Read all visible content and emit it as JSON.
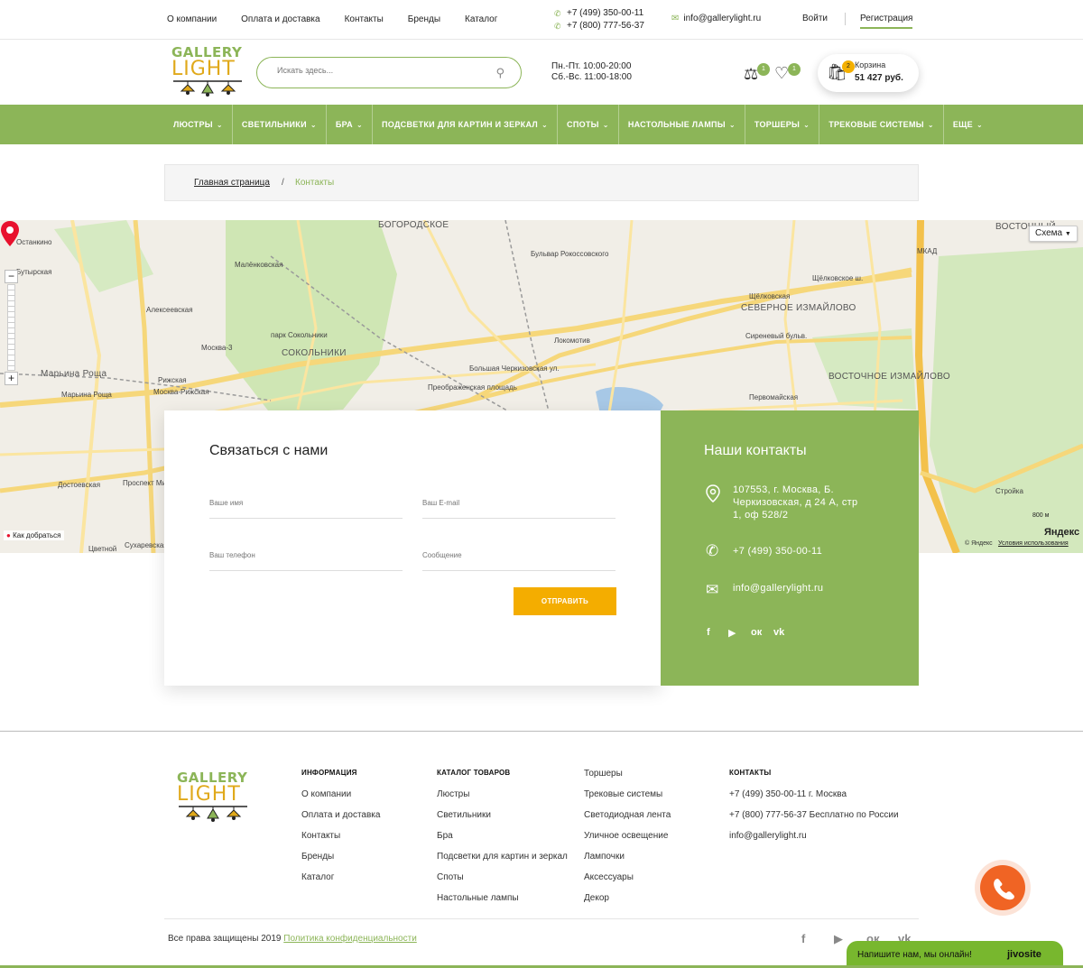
{
  "topbar": {
    "nav": [
      "О компании",
      "Оплата и доставка",
      "Контакты",
      "Бренды",
      "Каталог"
    ],
    "phone1": "+7 (499) 350-00-11",
    "phone2": "+7 (800) 777-56-37",
    "email": "info@gallerylight.ru",
    "login": "Войти",
    "register": "Регистрация"
  },
  "header": {
    "logo_line1": "GALLERY",
    "logo_line2": "LIGHT",
    "search_placeholder": "Искать здесь...",
    "hours_line1": "Пн.-Пт. 10:00-20:00",
    "hours_line2": "Сб.-Вс. 11:00-18:00",
    "compare_count": "1",
    "favorites_count": "1",
    "cart_count": "2",
    "cart_label": "Корзина",
    "cart_sum": "51 427 руб."
  },
  "menu": [
    "ЛЮСТРЫ",
    "СВЕТИЛЬНИКИ",
    "БРА",
    "ПОДСВЕТКИ ДЛЯ КАРТИН И ЗЕРКАЛ",
    "СПОТЫ",
    "НАСТОЛЬНЫЕ ЛАМПЫ",
    "ТОРШЕРЫ",
    "ТРЕКОВЫЕ СИСТЕМЫ",
    "ЕЩЕ"
  ],
  "breadcrumbs": {
    "home": "Главная страница",
    "separator": "/",
    "current": "Контакты"
  },
  "map": {
    "mode": "Схема",
    "route_link": "Как добраться",
    "copyright": "© Яндекс",
    "terms": "Условия использования",
    "brand": "Яндекс",
    "scale": "800 м",
    "labels": [
      "Останкино",
      "Бутырская",
      "Марьина Роща",
      "Алексеевская",
      "Рижская",
      "Москва-3",
      "Малёнковская",
      "СОКОЛЬНИКИ",
      "парк Сокольники",
      "БОГОРОДСКОЕ",
      "Бульвар Рокоссовского",
      "Локомотив",
      "Преображенская площадь",
      "Щёлковская",
      "СЕВЕРНОЕ ИЗМАЙЛОВО",
      "ВОСТОЧНОЕ ИЗМАЙЛОВО",
      "Москва-Рижская",
      "Марьина Роща",
      "Достоевская",
      "Сухаревская",
      "Цветной",
      "Проспект Мира",
      "Стройка",
      "Первомайская",
      "Сиреневый бульв.",
      "Щёлковское ш.",
      "Большая Черкизовская ул.",
      "ВОСТОЧНЫЙ",
      "МКАД"
    ]
  },
  "form": {
    "title": "Связаться с нами",
    "name_placeholder": "Ваше имя",
    "email_placeholder": "Ваш E-mail",
    "phone_placeholder": "Ваш телефон",
    "message_placeholder": "Сообщение",
    "submit": "ОТПРАВИТЬ"
  },
  "contacts": {
    "title": "Наши контакты",
    "address_line1": "107553, г. Москва, Б.",
    "address_line2": "Черкизовская, д 24 А, стр",
    "address_line3": "1, оф 528/2",
    "phone": "+7 (499) 350-00-11",
    "email": "info@gallerylight.ru",
    "social": [
      "f",
      "▶",
      "ок",
      "vk"
    ]
  },
  "footer": {
    "info_title": "ИНФОРМАЦИЯ",
    "info_items": [
      "О компании",
      "Оплата и доставка",
      "Контакты",
      "Бренды",
      "Каталог"
    ],
    "catalog_title": "КАТАЛОГ ТОВАРОВ",
    "catalog_items": [
      "Люстры",
      "Светильники",
      "Бра",
      "Подсветки для картин и зеркал",
      "Споты",
      "Настольные лампы"
    ],
    "catalog_items2": [
      "Торшеры",
      "Трековые системы",
      "Светодиодная лента",
      "Уличное освещение",
      "Лампочки",
      "Аксессуары",
      "Декор"
    ],
    "contacts_title": "КОНТАКТЫ",
    "contacts_items": [
      "+7 (499) 350-00-11 г. Москва",
      "+7 (800) 777-56-37 Бесплатно по России",
      "info@gallerylight.ru"
    ],
    "rights": "Все права защищены 2019",
    "privacy": "Политика конфиденциальности",
    "social": [
      "f",
      "▶",
      "ок",
      "vk"
    ]
  },
  "chat": {
    "text": "Напишите нам, мы онлайн!",
    "brand": "jivosite"
  },
  "colors": {
    "accent_green": "#8cb558",
    "button_orange": "#f4ad00",
    "call_button": "#f06424",
    "logo_gold": "#e0a91b"
  }
}
